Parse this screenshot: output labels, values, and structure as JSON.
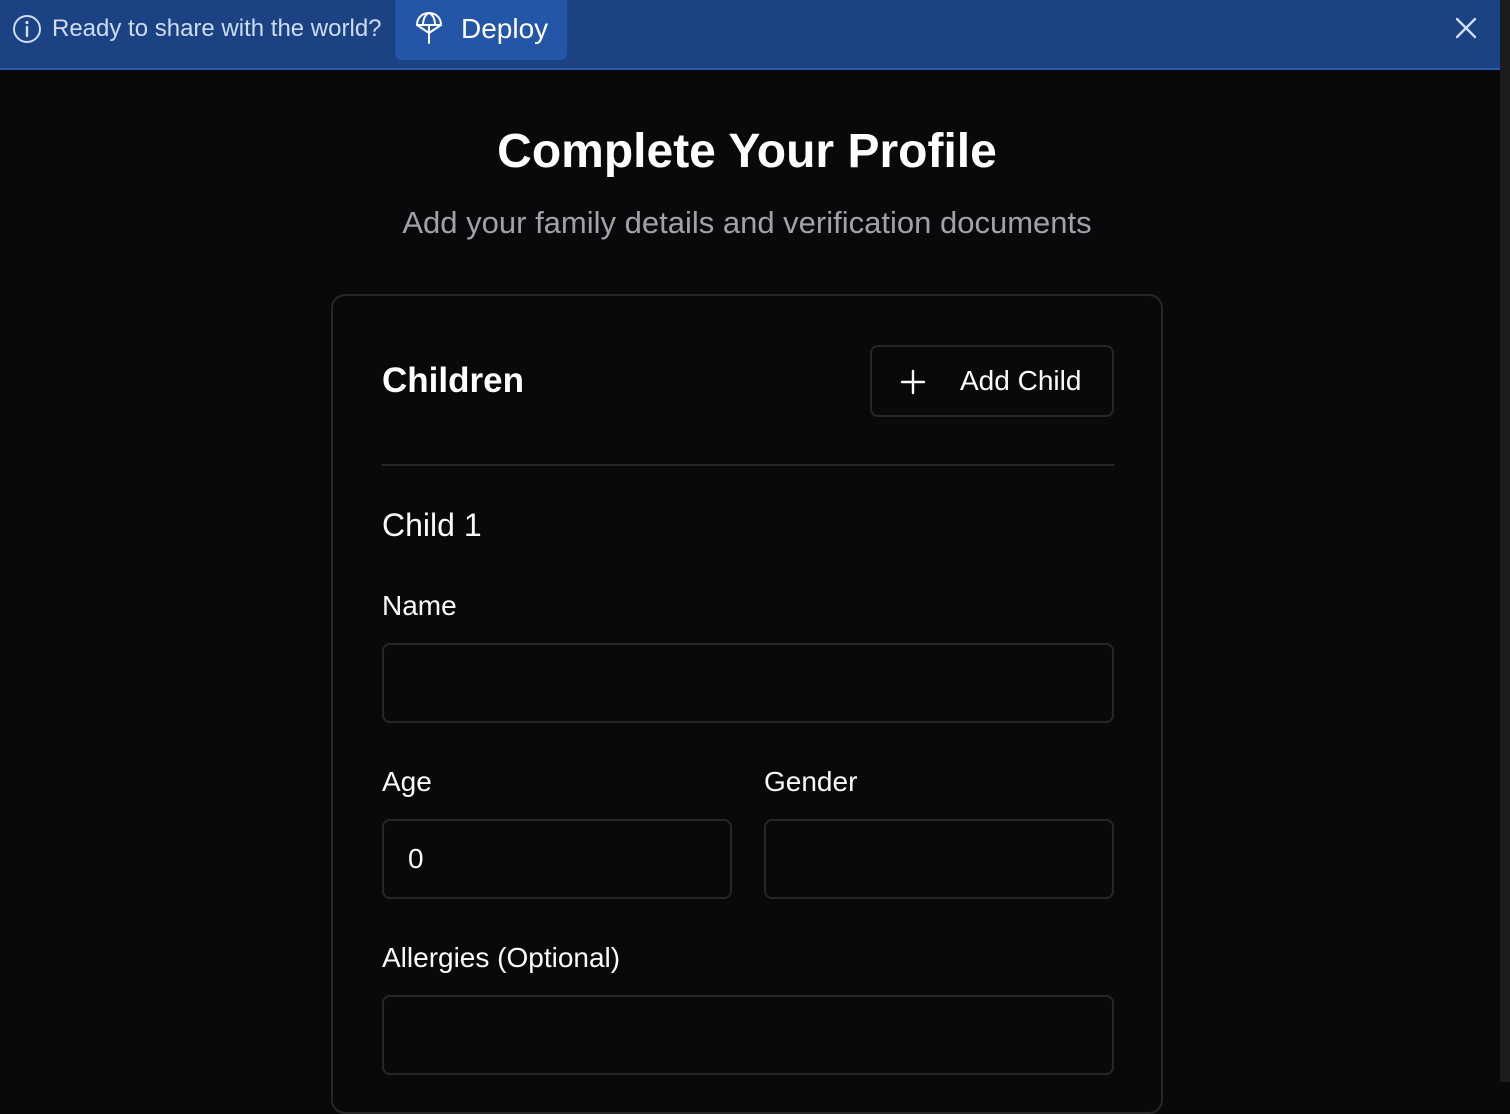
{
  "banner": {
    "message": "Ready to share with the world?",
    "deploy_label": "Deploy",
    "info_icon": "info-icon",
    "deploy_icon": "deploy-icon",
    "close_icon": "close-icon"
  },
  "header": {
    "title": "Complete Your Profile",
    "subtitle": "Add your family details and verification documents"
  },
  "children_section": {
    "title": "Children",
    "add_button_label": "Add Child",
    "add_button_icon": "plus-icon",
    "child": {
      "heading": "Child 1",
      "name_label": "Name",
      "name_value": "",
      "age_label": "Age",
      "age_value": "0",
      "gender_label": "Gender",
      "gender_value": "",
      "allergies_label": "Allergies (Optional)",
      "allergies_value": ""
    }
  },
  "colors": {
    "background": "#09090b",
    "banner": "#1b4283",
    "deploy_button": "#2356a6",
    "border": "#27272a",
    "muted_text": "#a1a1aa"
  }
}
